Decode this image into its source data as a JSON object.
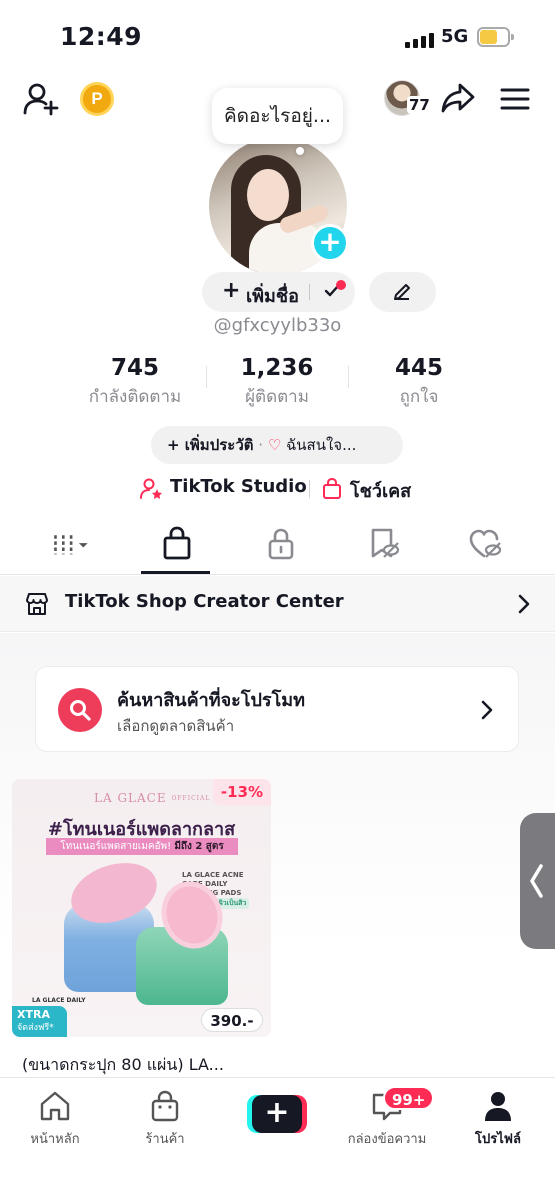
{
  "status_bar": {
    "time": "12:49",
    "network": "5G"
  },
  "top_bar": {
    "coin_label": "P",
    "friends_count": "77",
    "note_text": "คิดอะไรอยู่..."
  },
  "profile": {
    "add_name_label": "เพิ่มชื่อ",
    "username": "@gfxcyylb33o"
  },
  "stats": [
    {
      "value": "745",
      "label": "กำลังติดตาม"
    },
    {
      "value": "1,236",
      "label": "ผู้ติดตาม"
    },
    {
      "value": "445",
      "label": "ถูกใจ"
    }
  ],
  "bio": {
    "add_bio_label": "เพิ่มประวัติ",
    "separator": "·",
    "interest_label": "ฉันสนใจ..."
  },
  "links": {
    "studio_label": "TikTok Studio",
    "showcase_label": "โชว์เคส"
  },
  "shop_row": {
    "label": "TikTok Shop Creator Center"
  },
  "promo_card": {
    "title": "ค้นหาสินค้าที่จะโปรโมท",
    "subtitle": "เลือกดูตลาดสินค้า"
  },
  "product": {
    "brand": "LA GLACE",
    "brand_sub": "OFFICIAL STORE",
    "discount": "-13%",
    "headline": "#โทนเนอร์แพดลากลาส",
    "subline": "โทนเนอร์แพดสายเมคอัพ!",
    "subline_highlight": "มีถึง 2 สูตร",
    "tag_title": "LA GLACE ACNE CARE DAILY CALMING PADS",
    "tag_pill": "สูตรสำหรับผิวเป็นสิว",
    "jar_label": "LA GLACE DAILY",
    "xtra_title": "XTRA",
    "xtra_sub": "จัดส่งฟรี*",
    "price": "390.-",
    "title": "(ขนาดกระปุก 80 แผ่น) LA..."
  },
  "bottom_nav": {
    "items": [
      {
        "label": "หน้าหลัก"
      },
      {
        "label": "ร้านค้า"
      },
      {
        "label": "กล่องข้อความ"
      },
      {
        "label": "โปรไฟล์"
      }
    ],
    "inbox_badge": "99+"
  },
  "colors": {
    "accent": "#fe2c55",
    "cyan": "#25f4ee",
    "text": "#161823",
    "muted": "#8a8b91"
  }
}
